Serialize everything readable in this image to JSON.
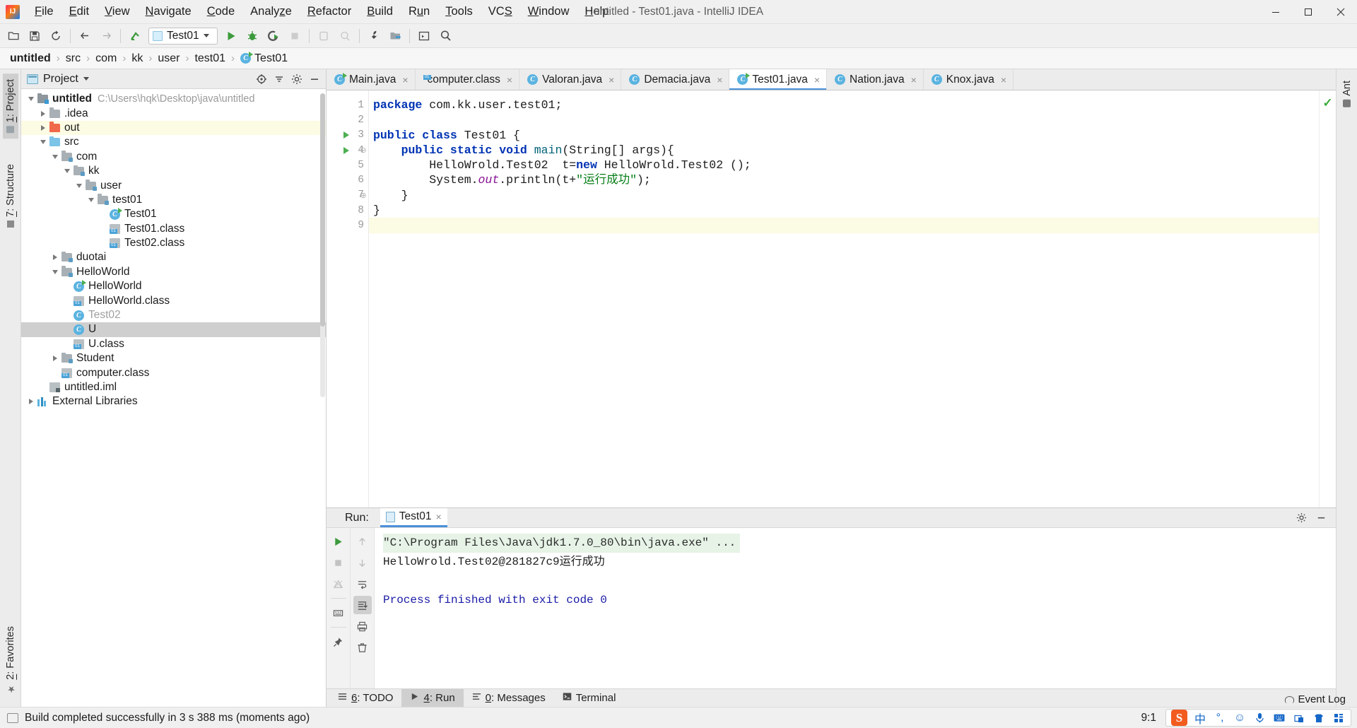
{
  "window": {
    "title": "untitled - Test01.java - IntelliJ IDEA",
    "minimize_label": "Minimize",
    "maximize_label": "Maximize",
    "close_label": "Close"
  },
  "menubar": {
    "items": [
      {
        "label": "File"
      },
      {
        "label": "Edit"
      },
      {
        "label": "View"
      },
      {
        "label": "Navigate"
      },
      {
        "label": "Code"
      },
      {
        "label": "Analyze"
      },
      {
        "label": "Refactor"
      },
      {
        "label": "Build"
      },
      {
        "label": "Run"
      },
      {
        "label": "Tools"
      },
      {
        "label": "VCS"
      },
      {
        "label": "Window"
      },
      {
        "label": "Help"
      }
    ]
  },
  "toolbar": {
    "open_icon": "open-folder-icon",
    "save_icon": "save-icon",
    "sync_icon": "sync-icon",
    "back_icon": "arrow-back-icon",
    "forward_icon": "arrow-forward-icon",
    "update_icon": "update-project-icon",
    "run_config": "Test01",
    "run_icon": "run-icon",
    "debug_icon": "debug-icon",
    "run_coverage_icon": "run-with-coverage-icon",
    "stop_icon": "stop-icon",
    "profiler_icon": "profiler-icon",
    "attach_icon": "attach-debugger-icon",
    "settings_icon": "wrench-settings-icon",
    "project_structure_icon": "project-structure-icon",
    "terminal_icon": "terminal-icon",
    "search_icon": "search-everywhere-icon"
  },
  "breadcrumb": {
    "items": [
      "untitled",
      "src",
      "com",
      "kk",
      "user",
      "test01"
    ],
    "file": "Test01",
    "separator": "›"
  },
  "left_toolwindows": [
    {
      "label": "1: Project",
      "shortcut": "1",
      "text": ": Project",
      "active": true,
      "icon": "project-window-icon"
    },
    {
      "label": "7: Structure",
      "shortcut": "7",
      "text": ": Structure",
      "active": false,
      "icon": "structure-icon"
    },
    {
      "label": "2: Favorites",
      "shortcut": "2",
      "text": ": Favorites",
      "active": false,
      "icon": "star-icon"
    }
  ],
  "right_toolwindows": [
    {
      "label": "Ant",
      "icon": "ant-build-icon"
    }
  ],
  "project_panel": {
    "title": "Project",
    "window_icon": "project-view-icon",
    "actions": [
      {
        "name": "locate-icon",
        "label": "Select Opened File"
      },
      {
        "name": "collapse-all-icon",
        "label": "Collapse All"
      },
      {
        "name": "gear-icon",
        "label": "Settings"
      },
      {
        "name": "hide-icon",
        "label": "Hide"
      }
    ],
    "tree": [
      {
        "depth": 0,
        "twist": "down",
        "icon": "project-root-icon",
        "label": "untitled",
        "bold": true,
        "path": "C:\\Users\\hqk\\Desktop\\java\\untitled",
        "state": "normal"
      },
      {
        "depth": 1,
        "twist": "right",
        "icon": "folder-gray-icon",
        "label": ".idea",
        "state": "normal"
      },
      {
        "depth": 1,
        "twist": "right",
        "icon": "folder-orange-icon",
        "label": "out",
        "state": "highlight"
      },
      {
        "depth": 1,
        "twist": "down",
        "icon": "folder-blue-icon",
        "label": "src",
        "state": "normal"
      },
      {
        "depth": 2,
        "twist": "down",
        "icon": "package-icon",
        "label": "com",
        "state": "normal"
      },
      {
        "depth": 3,
        "twist": "down",
        "icon": "package-icon",
        "label": "kk",
        "state": "normal"
      },
      {
        "depth": 4,
        "twist": "down",
        "icon": "package-icon",
        "label": "user",
        "state": "normal"
      },
      {
        "depth": 5,
        "twist": "down",
        "icon": "package-icon",
        "label": "test01",
        "state": "normal"
      },
      {
        "depth": 6,
        "twist": "none",
        "icon": "java-class-run-icon",
        "label": "Test01",
        "state": "normal"
      },
      {
        "depth": 6,
        "twist": "none",
        "icon": "compiled-class-icon",
        "label": "Test01.class",
        "state": "normal"
      },
      {
        "depth": 6,
        "twist": "none",
        "icon": "compiled-class-icon",
        "label": "Test02.class",
        "state": "normal"
      },
      {
        "depth": 2,
        "twist": "right",
        "icon": "package-icon",
        "label": "duotai",
        "state": "normal"
      },
      {
        "depth": 2,
        "twist": "down",
        "icon": "package-icon",
        "label": "HelloWorld",
        "state": "normal"
      },
      {
        "depth": 3,
        "twist": "none",
        "icon": "java-class-run-icon",
        "label": "HelloWorld",
        "state": "normal"
      },
      {
        "depth": 3,
        "twist": "none",
        "icon": "compiled-class-icon",
        "label": "HelloWorld.class",
        "state": "normal"
      },
      {
        "depth": 3,
        "twist": "none",
        "icon": "java-class-icon",
        "label": "Test02",
        "state": "muted"
      },
      {
        "depth": 3,
        "twist": "none",
        "icon": "java-class-icon",
        "label": "U",
        "state": "selected"
      },
      {
        "depth": 3,
        "twist": "none",
        "icon": "compiled-class-icon",
        "label": "U.class",
        "state": "normal"
      },
      {
        "depth": 2,
        "twist": "right",
        "icon": "package-icon",
        "label": "Student",
        "state": "normal"
      },
      {
        "depth": 2,
        "twist": "none",
        "icon": "compiled-class-icon",
        "label": "computer.class",
        "state": "normal"
      },
      {
        "depth": 1,
        "twist": "none",
        "icon": "iml-file-icon",
        "label": "untitled.iml",
        "state": "normal"
      },
      {
        "depth": 0,
        "twist": "right",
        "icon": "libraries-icon",
        "label": "External Libraries",
        "state": "normal"
      }
    ]
  },
  "editor": {
    "tabs": [
      {
        "label": "Main.java",
        "icon": "java-class-run-icon",
        "active": false
      },
      {
        "label": "computer.class",
        "icon": "compiled-class-icon",
        "active": false
      },
      {
        "label": "Valoran.java",
        "icon": "java-class-icon",
        "active": false
      },
      {
        "label": "Demacia.java",
        "icon": "java-class-icon",
        "active": false
      },
      {
        "label": "Test01.java",
        "icon": "java-class-run-icon",
        "active": true
      },
      {
        "label": "Nation.java",
        "icon": "java-class-icon",
        "active": false
      },
      {
        "label": "Knox.java",
        "icon": "java-class-icon",
        "active": false
      }
    ],
    "close_glyph": "×",
    "line_numbers": [
      "1",
      "2",
      "3",
      "4",
      "5",
      "6",
      "7",
      "8",
      "9"
    ],
    "caret_line": 9,
    "gutter_run_markers": [
      3,
      4
    ],
    "inspection_status": "✓",
    "code_lines": [
      {
        "n": 1,
        "segments": [
          {
            "t": "package ",
            "c": "kw"
          },
          {
            "t": "com.kk.user.test01;",
            "c": ""
          }
        ]
      },
      {
        "n": 2,
        "segments": []
      },
      {
        "n": 3,
        "segments": [
          {
            "t": "public class ",
            "c": "kw"
          },
          {
            "t": "Test01 {",
            "c": ""
          }
        ]
      },
      {
        "n": 4,
        "segments": [
          {
            "t": "    ",
            "c": ""
          },
          {
            "t": "public static void ",
            "c": "kw"
          },
          {
            "t": "main",
            "c": "mth"
          },
          {
            "t": "(String[] args){",
            "c": ""
          }
        ]
      },
      {
        "n": 5,
        "segments": [
          {
            "t": "        HelloWrold.Test02  t=",
            "c": ""
          },
          {
            "t": "new ",
            "c": "kw"
          },
          {
            "t": "HelloWrold.Test02 ();",
            "c": ""
          }
        ]
      },
      {
        "n": 6,
        "segments": [
          {
            "t": "        System.",
            "c": ""
          },
          {
            "t": "out",
            "c": "fld"
          },
          {
            "t": ".println(t+",
            "c": ""
          },
          {
            "t": "\"运行成功\"",
            "c": "str"
          },
          {
            "t": ");",
            "c": ""
          }
        ]
      },
      {
        "n": 7,
        "segments": [
          {
            "t": "    }",
            "c": ""
          }
        ]
      },
      {
        "n": 8,
        "segments": [
          {
            "t": "}",
            "c": ""
          }
        ]
      },
      {
        "n": 9,
        "segments": []
      }
    ]
  },
  "run_panel": {
    "label": "Run:",
    "tab": "Test01",
    "tab_icon": "run-config-doc-icon",
    "close_glyph": "×",
    "header_actions": [
      {
        "name": "gear-icon",
        "label": "Settings"
      },
      {
        "name": "hide-icon",
        "label": "Hide"
      }
    ],
    "left_tools": [
      {
        "name": "rerun-icon",
        "label": "Rerun",
        "state": "enabled"
      },
      {
        "name": "stop-icon",
        "label": "Stop",
        "state": "dim"
      },
      {
        "name": "thread-dump-icon",
        "label": "Thread Dump",
        "state": "dim"
      },
      {
        "name": "keyboard-icon",
        "label": "Console",
        "state": "enabled"
      },
      {
        "name": "pin-icon",
        "label": "Pin Tab",
        "state": "enabled"
      }
    ],
    "right_tools": [
      {
        "name": "arrow-up-icon",
        "label": "Up the Stack Trace",
        "state": "dim"
      },
      {
        "name": "arrow-down-icon",
        "label": "Down the Stack Trace",
        "state": "dim"
      },
      {
        "name": "soft-wrap-icon",
        "label": "Soft-Wrap",
        "state": "enabled"
      },
      {
        "name": "scroll-end-icon",
        "label": "Scroll to End",
        "state": "active"
      },
      {
        "name": "print-icon",
        "label": "Print",
        "state": "enabled"
      },
      {
        "name": "clear-all-icon",
        "label": "Clear All",
        "state": "enabled"
      }
    ],
    "console": [
      {
        "text": "\"C:\\Program Files\\Java\\jdk1.7.0_80\\bin\\java.exe\" ...",
        "style": "cmd"
      },
      {
        "text": "HelloWrold.Test02@281827c9运行成功",
        "style": "link"
      },
      {
        "text": "",
        "style": "plain"
      },
      {
        "text": "Process finished with exit code 0",
        "style": "exit"
      }
    ]
  },
  "bottom_toolwindows": [
    {
      "label": "6: TODO",
      "shortcut": "6",
      "text": ": TODO",
      "icon": "todo-icon",
      "active": false
    },
    {
      "label": "4: Run",
      "shortcut": "4",
      "text": ": Run",
      "icon": "run-icon",
      "active": true
    },
    {
      "label": "0: Messages",
      "shortcut": "0",
      "text": ": Messages",
      "icon": "messages-icon",
      "active": false
    },
    {
      "label": "Terminal",
      "shortcut": "",
      "text": "Terminal",
      "icon": "terminal-icon",
      "active": false
    }
  ],
  "statusbar": {
    "message": "Build completed successfully in 3 s 388 ms (moments ago)",
    "message_icon": "build-status-icon",
    "caret_position": "9:1",
    "event_log": "Event Log",
    "event_log_icon": "bell-icon",
    "ime": {
      "logo": "S",
      "items": [
        {
          "name": "ime-chinese-mode",
          "glyph": "中"
        },
        {
          "name": "ime-punctuation",
          "glyph": "°,"
        },
        {
          "name": "ime-emoji",
          "glyph": "☺"
        },
        {
          "name": "ime-voice",
          "glyph": "\u0001"
        },
        {
          "name": "ime-keyboard",
          "glyph": "⌨"
        },
        {
          "name": "ime-toolbox",
          "glyph": "▤"
        },
        {
          "name": "ime-skin",
          "glyph": "♣"
        },
        {
          "name": "ime-menu",
          "glyph": "▦"
        }
      ]
    }
  },
  "colors": {
    "accent": "#4a90d9",
    "keyword": "#0033b3",
    "string": "#067d17",
    "field": "#871094",
    "method": "#00627a",
    "run_green": "#4caf50",
    "highlight_yellow": "#fcfbe3",
    "selection_gray": "#cfcfcf"
  }
}
